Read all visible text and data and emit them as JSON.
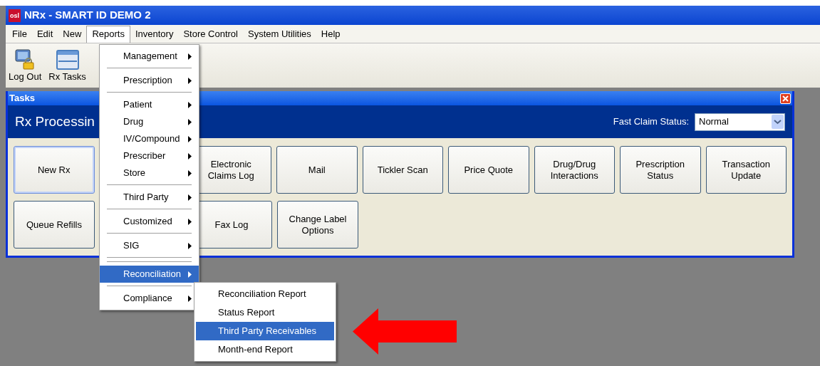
{
  "window": {
    "title": "NRx - SMART ID DEMO 2",
    "logo": "osl"
  },
  "menu_bar": [
    {
      "label": "File",
      "selected": false
    },
    {
      "label": "Edit",
      "selected": false
    },
    {
      "label": "New",
      "selected": false
    },
    {
      "label": "Reports",
      "selected": true
    },
    {
      "label": "Inventory",
      "selected": false
    },
    {
      "label": "Store Control",
      "selected": false
    },
    {
      "label": "System Utilities",
      "selected": false
    },
    {
      "label": "Help",
      "selected": false
    }
  ],
  "toolbar": [
    {
      "label": "Log Out",
      "kind": "logout"
    },
    {
      "label": "Rx Tasks",
      "kind": "tasks"
    }
  ],
  "tasks_window": {
    "title": "Tasks",
    "header": "Rx Processin",
    "fast_claim_label": "Fast Claim Status:",
    "fast_claim_value": "Normal",
    "buttons": [
      [
        {
          "label": "New Rx",
          "selected": true
        },
        {
          "label": "Electronic Claims Log",
          "selected": false
        },
        {
          "label": "Mail",
          "selected": false
        },
        {
          "label": "Tickler Scan",
          "selected": false
        },
        {
          "label": "Price Quote",
          "selected": false
        },
        {
          "label": "Drug/Drug Interactions",
          "selected": false
        },
        {
          "label": "Prescription Status",
          "selected": false
        },
        {
          "label": "Transaction Update",
          "selected": false
        }
      ],
      [
        {
          "label": "Queue Refills",
          "selected": false
        },
        {
          "label": "Fax Log",
          "selected": false
        },
        {
          "label": "Change Label Options",
          "selected": false
        }
      ]
    ]
  },
  "reports_menu": [
    {
      "kind": "item",
      "label": "Management",
      "selected": false
    },
    {
      "kind": "separator"
    },
    {
      "kind": "item",
      "label": "Prescription",
      "selected": false
    },
    {
      "kind": "separator"
    },
    {
      "kind": "item",
      "label": "Patient",
      "selected": false
    },
    {
      "kind": "item",
      "label": "Drug",
      "selected": false
    },
    {
      "kind": "item",
      "label": "IV/Compound",
      "selected": false
    },
    {
      "kind": "item",
      "label": "Prescriber",
      "selected": false
    },
    {
      "kind": "item",
      "label": "Store",
      "selected": false
    },
    {
      "kind": "separator"
    },
    {
      "kind": "item",
      "label": "Third Party",
      "selected": false
    },
    {
      "kind": "separator"
    },
    {
      "kind": "item",
      "label": "Customized",
      "selected": false
    },
    {
      "kind": "separator"
    },
    {
      "kind": "item",
      "label": "SIG",
      "selected": false
    },
    {
      "kind": "separator"
    },
    {
      "kind": "separator"
    },
    {
      "kind": "item",
      "label": "Reconciliation",
      "selected": true
    },
    {
      "kind": "separator"
    },
    {
      "kind": "item",
      "label": "Compliance",
      "selected": false
    }
  ],
  "reconciliation_submenu": [
    {
      "label": "Reconciliation Report",
      "selected": false
    },
    {
      "label": "Status Report",
      "selected": false
    },
    {
      "label": "Third Party Receivables",
      "selected": true
    },
    {
      "label": "Month-end Report",
      "selected": false
    }
  ]
}
